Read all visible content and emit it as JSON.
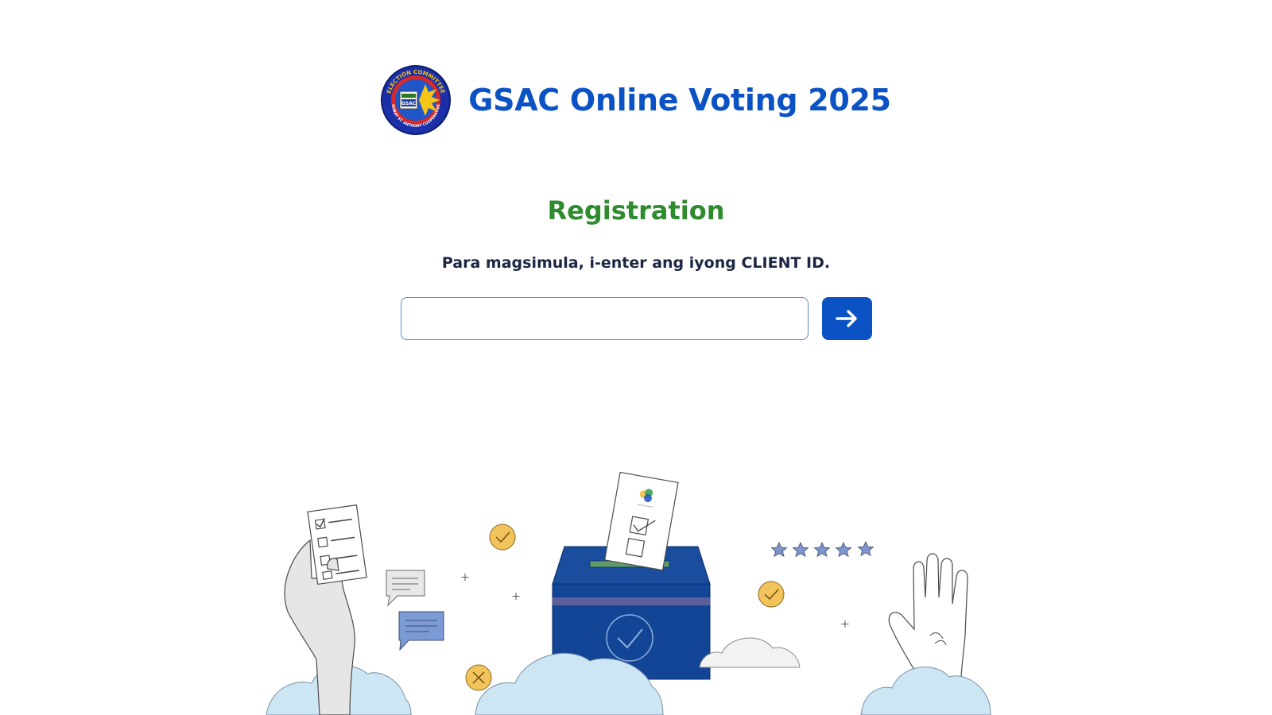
{
  "header": {
    "title": "GSAC Online Voting 2025",
    "logo": {
      "icon": "gsac-cooperative-seal-icon",
      "text_top": "ELECTION COMMITTEE",
      "text_bottom": "GOBAT ST. ANTHONY COOPERATIVE",
      "text_center": "GSAC"
    }
  },
  "registration": {
    "title": "Registration",
    "instructions": "Para magsimula, i-enter ang iyong CLIENT ID.",
    "client_id_input": {
      "value": "",
      "placeholder": ""
    },
    "submit_icon": "arrow-right-icon"
  },
  "colors": {
    "primary": "#0b52c4",
    "accent_green": "#2e8b2e",
    "text_dark": "#1c2541",
    "ballot_box": "#0f4a9c",
    "cloud": "#cde6f4",
    "check_badge": "#f2c35b",
    "star": "#7e95c9"
  }
}
